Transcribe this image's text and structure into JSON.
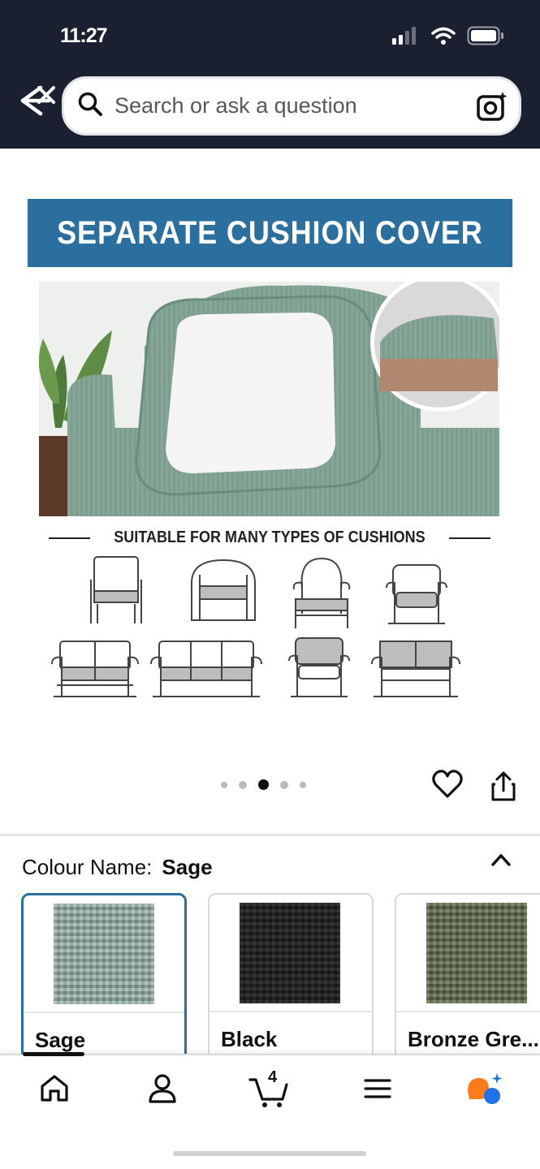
{
  "status_bar": {
    "time": "11:27"
  },
  "search": {
    "placeholder": "Search or ask a question"
  },
  "product_image": {
    "banner_title": "SEPARATE CUSHION COVER",
    "suitable_text": "SUITABLE FOR MANY TYPES OF CUSHIONS",
    "carousel": {
      "count": 5,
      "active_index": 2
    }
  },
  "colour": {
    "label": "Colour Name:",
    "selected": "Sage",
    "options": [
      {
        "name": "Sage",
        "color": "#8aa99e"
      },
      {
        "name": "Black",
        "color": "#222222"
      },
      {
        "name": "Bronze Gre...",
        "color": "#5c6a48"
      }
    ]
  },
  "bottom_nav": {
    "items": [
      "home-icon",
      "account-icon",
      "cart-icon",
      "menu-icon",
      "rufus-icon"
    ],
    "cart_count": "4"
  },
  "colors": {
    "header_bg": "#1a2030",
    "banner_blue": "#2a6f9e",
    "selected_border": "#2a6f9e"
  }
}
